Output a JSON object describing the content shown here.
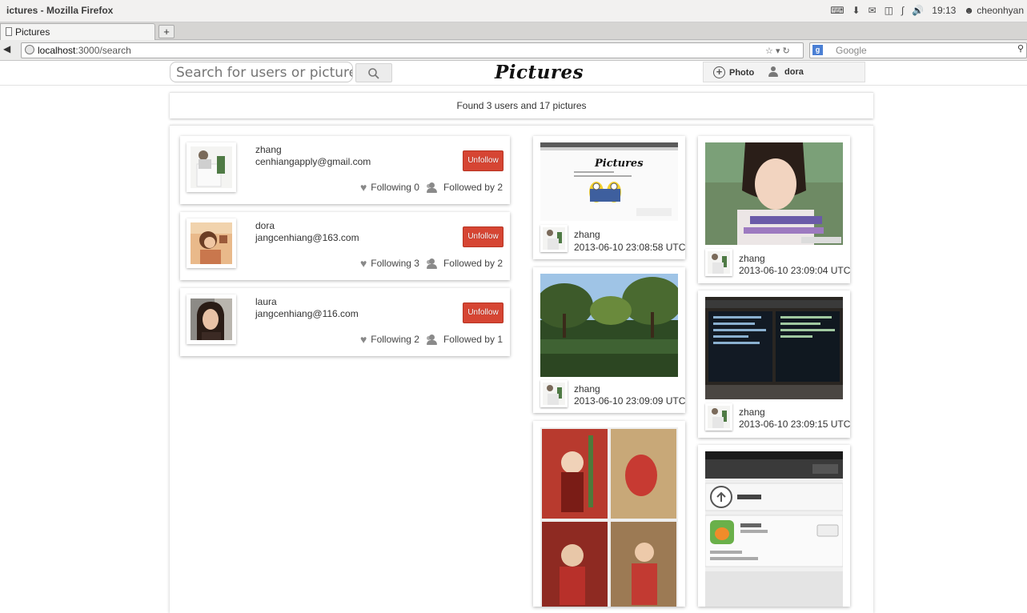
{
  "os": {
    "window_title": "ictures - Mozilla Firefox",
    "clock": "19:13",
    "user": "cheonhyan"
  },
  "browser": {
    "tab_title": "Pictures",
    "new_tab_symbol": "+",
    "url_host": "localhost",
    "url_path": ":3000/search",
    "search_engine": "Google",
    "search_placeholder": "Google"
  },
  "header": {
    "search_placeholder": "Search for users or pictures",
    "logo": "Pictures",
    "photo_label": "Photo",
    "username": "dora"
  },
  "summary": {
    "text": "Found 3 users and 17 pictures"
  },
  "users": [
    {
      "name": "zhang",
      "email": "cenhiangapply@gmail.com",
      "button": "Unfollow",
      "following": "Following 0",
      "followed_by": "Followed by 2"
    },
    {
      "name": "dora",
      "email": "jangcenhiang@163.com",
      "button": "Unfollow",
      "following": "Following 3",
      "followed_by": "Followed by 2"
    },
    {
      "name": "laura",
      "email": "jangcenhiang@116.com",
      "button": "Unfollow",
      "following": "Following 2",
      "followed_by": "Followed by 1"
    }
  ],
  "pictures": [
    {
      "owner": "zhang",
      "time": "2013-06-10 23:08:58 UTC",
      "caption": "Pictures"
    },
    {
      "owner": "zhang",
      "time": "2013-06-10 23:09:04 UTC"
    },
    {
      "owner": "zhang",
      "time": "2013-06-10 23:09:09 UTC"
    },
    {
      "owner": "zhang",
      "time": "2013-06-10 23:09:15 UTC"
    }
  ],
  "icons": {
    "back": "back-arrow-icon",
    "site": "globe-icon",
    "search": "search-icon",
    "add_photo": "plus-circle-icon",
    "user": "person-icon",
    "following": "heart-icon",
    "followers": "group-icon"
  },
  "colors": {
    "unfollow_button": "#d64533",
    "page_background": "#ffffff",
    "header_bar": "#f3f3f3"
  }
}
